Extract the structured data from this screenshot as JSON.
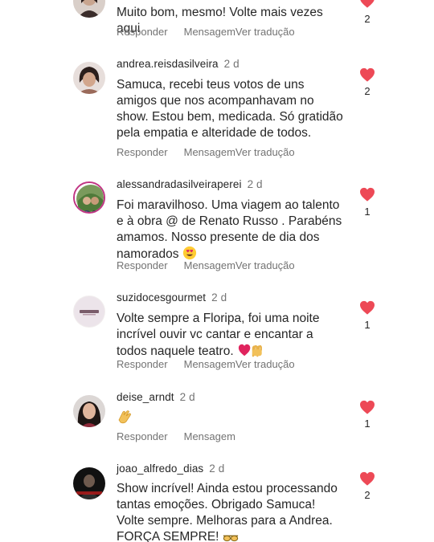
{
  "colors": {
    "heart": "#ed4956",
    "text": "#262626",
    "secondary": "#737373"
  },
  "icons": {
    "like": "heart-filled-icon"
  },
  "comments": [
    {
      "username": "",
      "time": "",
      "text": "Muito bom, mesmo! Volte mais vezes aqui",
      "reply": "Responder",
      "message": "Mensagem",
      "translate": "Ver tradução",
      "likes": "2"
    },
    {
      "username": "andrea.reisdasilveira",
      "time": "2 d",
      "text": "Samuca, recebi teus votos de uns amigos que nos acompanhavam no show. Estou bem, medicada. Só gratidão pela empatia e alteridade de todos.",
      "reply": "Responder",
      "message": "Mensagem",
      "translate": "Ver tradução",
      "likes": "2"
    },
    {
      "username": "alessandradasilveiraperei",
      "time": "2 d",
      "text": "Foi maravilhoso. Uma viagem ao talento e à obra @ de Renato Russo . Parabéns amamos. Nosso presente de dia dos namorados",
      "emoji": "heart-eyes-emoji",
      "reply": "Responder",
      "message": "Mensagem",
      "translate": "Ver tradução",
      "likes": "1"
    },
    {
      "username": "suzidocesgourmet",
      "time": "2 d",
      "text": "Volte sempre a Floripa, foi uma noite incrível ouvir vc cantar e encantar a todos naquele teatro.",
      "emoji": "heart-and-raised-hands-emoji",
      "reply": "Responder",
      "message": "Mensagem",
      "translate": "Ver tradução",
      "likes": "1"
    },
    {
      "username": "deise_arndt",
      "time": "2 d",
      "text": "",
      "emoji": "clapping-hands-emoji",
      "reply": "Responder",
      "message": "Mensagem",
      "likes": "1"
    },
    {
      "username": "joao_alfredo_dias",
      "time": "2 d",
      "text": "Show incrível! Ainda estou processando tantas emoções. Obrigado Samuca! Volte sempre. Melhoras para a Andrea. FORÇA SEMPRE!",
      "emoji": "sunglasses-emoji",
      "likes": "2"
    }
  ]
}
